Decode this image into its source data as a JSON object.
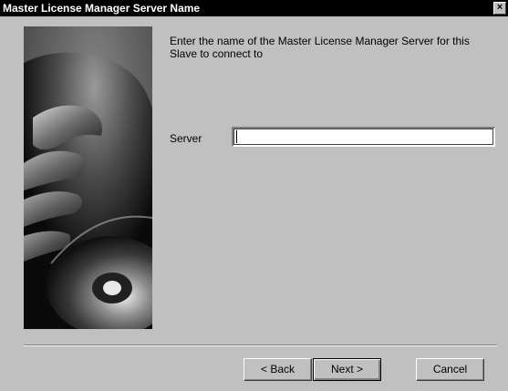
{
  "window": {
    "title": "Master License Manager Server Name",
    "close_glyph": "×"
  },
  "main": {
    "instruction": "Enter the name of the Master License Manager Server for this Slave to connect to",
    "server_label": "Server",
    "server_value": ""
  },
  "footer": {
    "back_label": "< Back",
    "next_label": "Next >",
    "cancel_label": "Cancel"
  },
  "icons": {
    "close": "close-icon",
    "side_image": "hand-disc-illustration"
  }
}
